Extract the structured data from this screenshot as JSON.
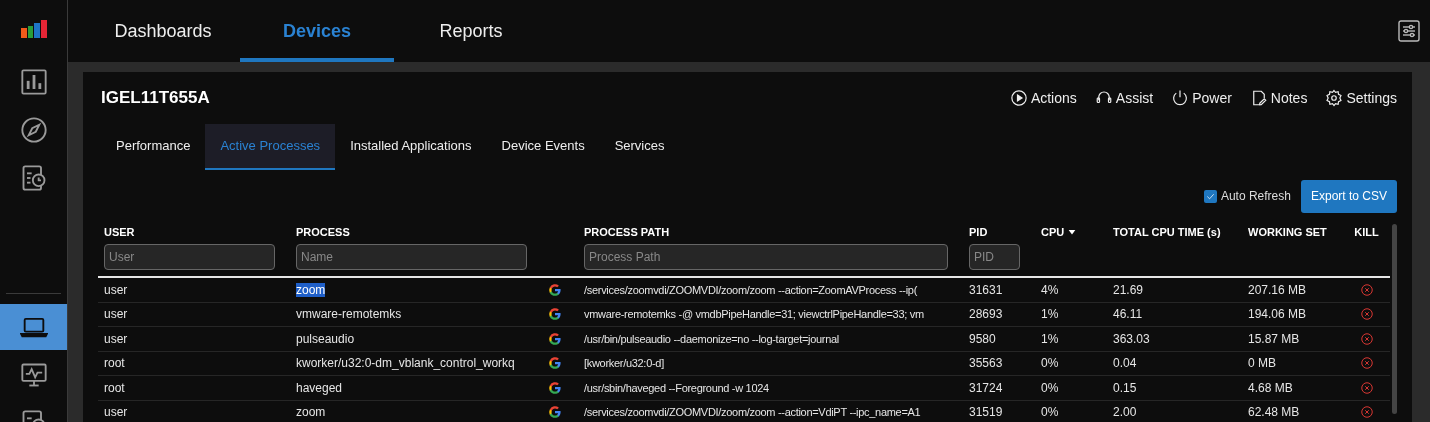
{
  "sidebar": {
    "top_items": [
      {
        "kind": "bar-chart",
        "selected": false
      },
      {
        "kind": "compass",
        "selected": false
      },
      {
        "kind": "report-clock",
        "selected": false
      }
    ],
    "bottom_items": [
      {
        "kind": "laptop",
        "selected": true
      },
      {
        "kind": "monitor-pulse",
        "selected": false
      },
      {
        "kind": "report-clock",
        "selected": false
      }
    ]
  },
  "nav_tabs": [
    {
      "label": "Dashboards",
      "selected": false
    },
    {
      "label": "Devices",
      "selected": true
    },
    {
      "label": "Reports",
      "selected": false
    }
  ],
  "device": {
    "name": "IGEL11T655A",
    "actions": [
      {
        "kind": "play",
        "label": "Actions"
      },
      {
        "kind": "headset",
        "label": "Assist"
      },
      {
        "kind": "power",
        "label": "Power"
      },
      {
        "kind": "note",
        "label": "Notes"
      },
      {
        "kind": "gear",
        "label": "Settings"
      }
    ],
    "tabs": [
      {
        "label": "Performance",
        "selected": false
      },
      {
        "label": "Active Processes",
        "selected": true
      },
      {
        "label": "Installed Applications",
        "selected": false
      },
      {
        "label": "Device Events",
        "selected": false
      },
      {
        "label": "Services",
        "selected": false
      }
    ],
    "auto_refresh": {
      "label": "Auto Refresh",
      "checked": true
    },
    "export_button": "Export to CSV",
    "table": {
      "columns": [
        {
          "label": "USER",
          "placeholder": "User"
        },
        {
          "label": "PROCESS",
          "placeholder": "Name"
        },
        {
          "label": "PROCESS PATH",
          "placeholder": "Process Path"
        },
        {
          "label": "PID",
          "placeholder": "PID"
        },
        {
          "label": "CPU",
          "sorted_descending": true
        },
        {
          "label": "TOTAL CPU TIME (s)"
        },
        {
          "label": "WORKING SET"
        },
        {
          "label": "KILL"
        }
      ],
      "rows": [
        {
          "user": "user",
          "process": "zoom",
          "process_highlighted": true,
          "path": "/services/zoomvdi/ZOOMVDI/zoom/zoom --action=ZoomAVProcess --ip(",
          "pid": "31631",
          "cpu": "4%",
          "cpu_time": "21.69",
          "working_set": "207.16 MB"
        },
        {
          "user": "user",
          "process": "vmware-remotemks",
          "process_highlighted": false,
          "path": "vmware-remotemks -@ vmdbPipeHandle=31; viewctrlPipeHandle=33; vm",
          "pid": "28693",
          "cpu": "1%",
          "cpu_time": "46.11",
          "working_set": "194.06 MB"
        },
        {
          "user": "user",
          "process": "pulseaudio",
          "process_highlighted": false,
          "path": "/usr/bin/pulseaudio --daemonize=no --log-target=journal",
          "pid": "9580",
          "cpu": "1%",
          "cpu_time": "363.03",
          "working_set": "15.87 MB"
        },
        {
          "user": "root",
          "process": "kworker/u32:0-dm_vblank_control_workq",
          "process_highlighted": false,
          "path": "[kworker/u32:0-d]",
          "pid": "35563",
          "cpu": "0%",
          "cpu_time": "0.04",
          "working_set": "0 MB"
        },
        {
          "user": "root",
          "process": "haveged",
          "process_highlighted": false,
          "path": "/usr/sbin/haveged --Foreground -w 1024",
          "pid": "31724",
          "cpu": "0%",
          "cpu_time": "0.15",
          "working_set": "4.68 MB"
        },
        {
          "user": "user",
          "process": "zoom",
          "process_highlighted": false,
          "path": "/services/zoomvdi/ZOOMVDI/zoom/zoom --action=VdiPT --ipc_name=A1",
          "pid": "31519",
          "cpu": "0%",
          "cpu_time": "2.00",
          "working_set": "62.48 MB"
        }
      ]
    }
  }
}
